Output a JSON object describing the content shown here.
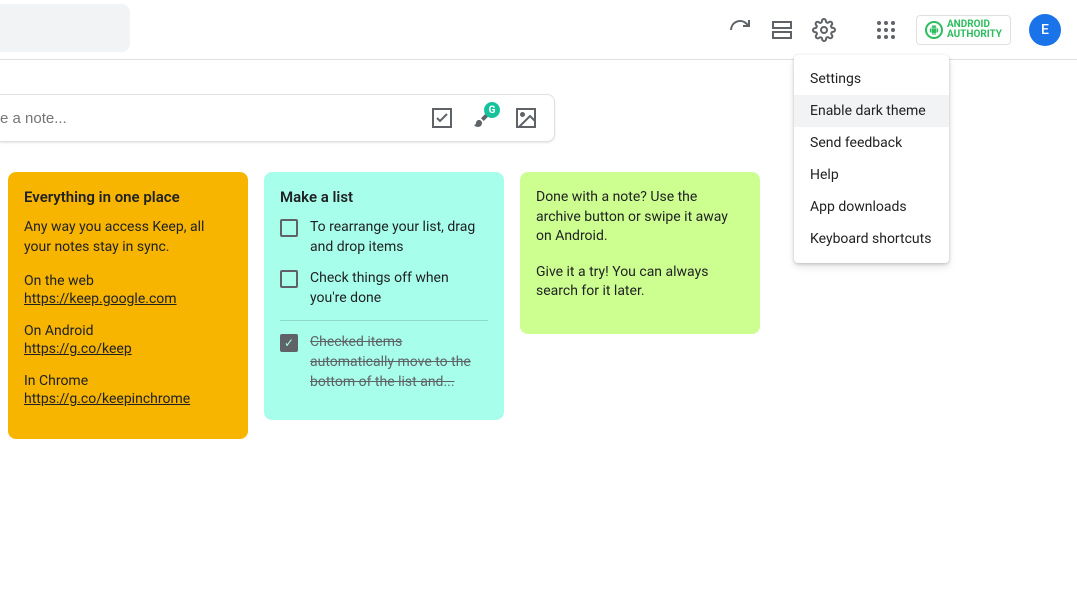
{
  "header": {
    "avatar_letter": "E",
    "logo_line1": "ANDROID",
    "logo_line2": "AUTHORITY"
  },
  "dropdown": {
    "items": [
      {
        "label": "Settings",
        "highlighted": false
      },
      {
        "label": "Enable dark theme",
        "highlighted": true
      },
      {
        "label": "Send feedback",
        "highlighted": false
      },
      {
        "label": "Help",
        "highlighted": false
      },
      {
        "label": "App downloads",
        "highlighted": false
      },
      {
        "label": "Keyboard shortcuts",
        "highlighted": false
      }
    ]
  },
  "compose": {
    "placeholder": "e a note..."
  },
  "notes": [
    {
      "color": "orange",
      "title": "Everything in one place",
      "content": {
        "intro": "Any way you access Keep, all your notes stay in sync.",
        "links": [
          {
            "label": "On the web",
            "url": "https://keep.google.com"
          },
          {
            "label": "On Android",
            "url": "https://g.co/keep"
          },
          {
            "label": "In Chrome",
            "url": "https://g.co/keepinchrome"
          }
        ]
      }
    },
    {
      "color": "teal",
      "title": "Make a list",
      "list": [
        {
          "text": "To rearrange your list, drag and drop items",
          "done": false
        },
        {
          "text": "Check things off when you're done",
          "done": false
        },
        {
          "text": "Checked items automatically move to the bottom of the list and...",
          "done": true
        }
      ]
    },
    {
      "color": "green",
      "body": [
        "Done with a note? Use the archive button or swipe it away on Android.",
        "Give it a try! You can always search for it later."
      ]
    }
  ]
}
